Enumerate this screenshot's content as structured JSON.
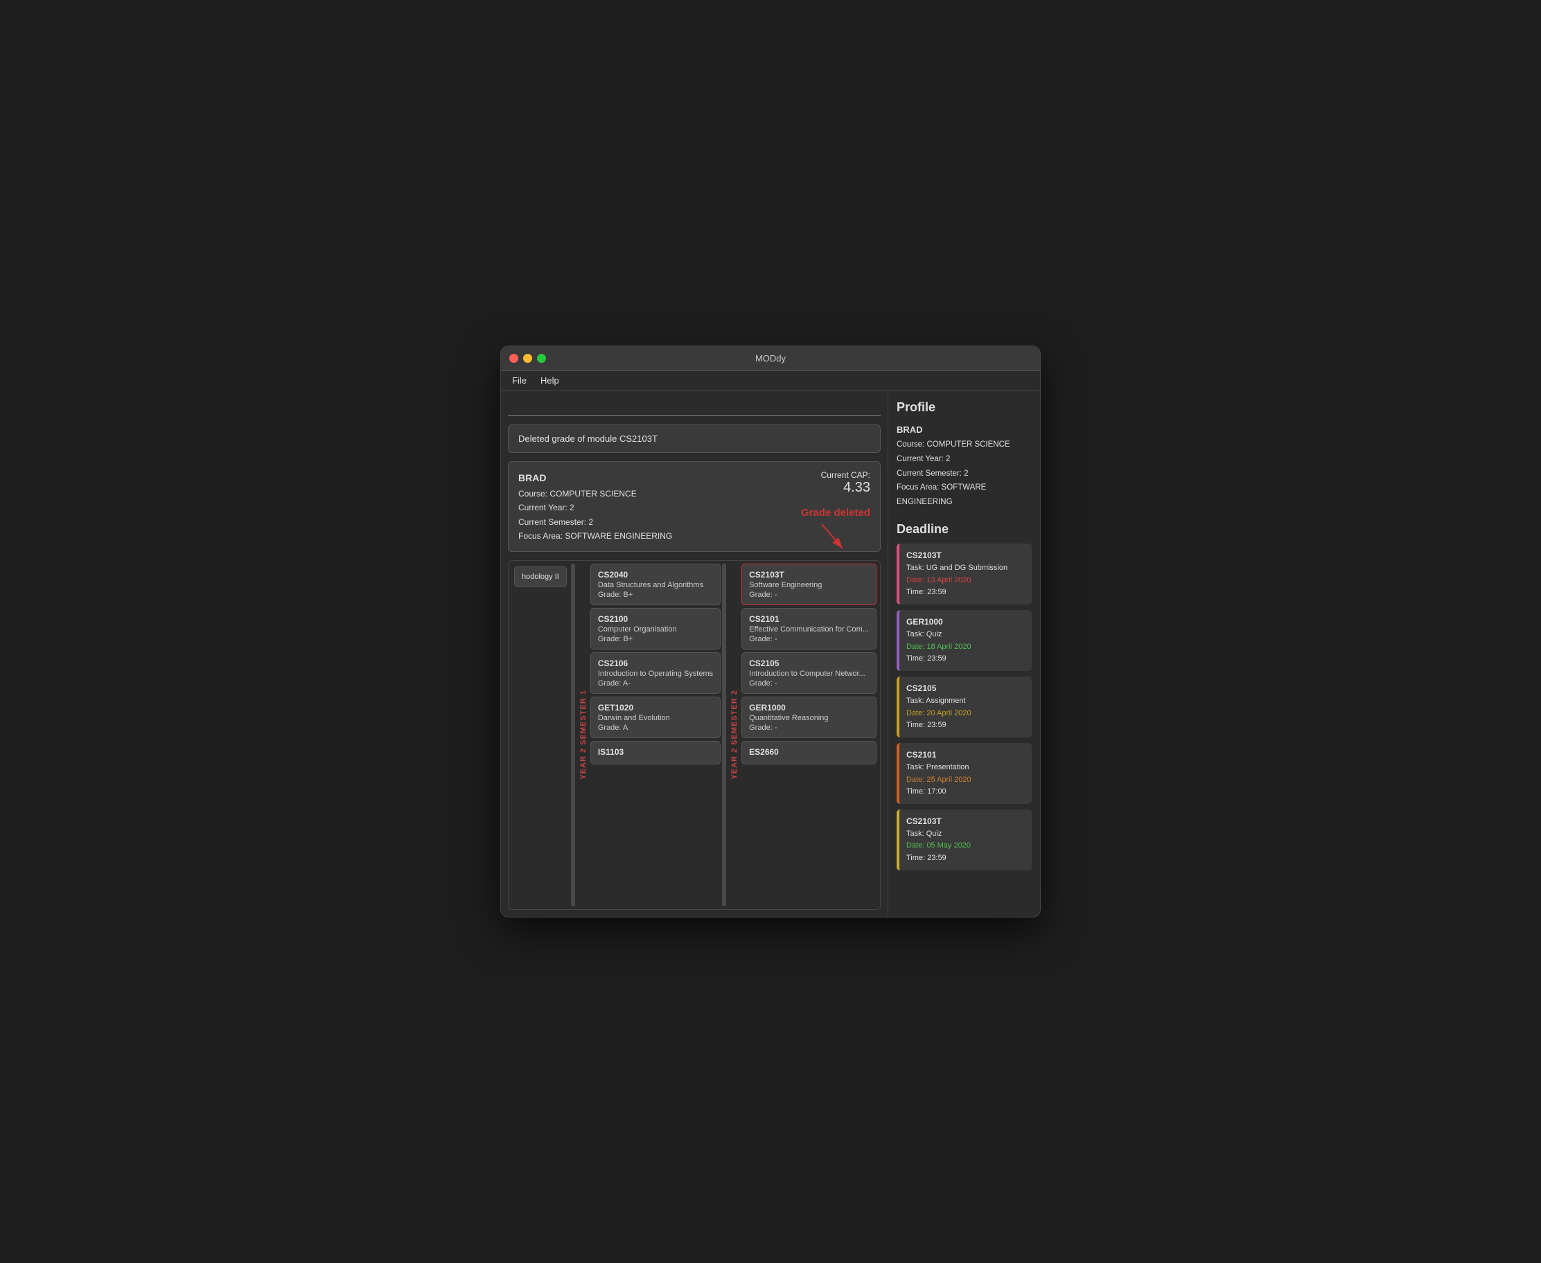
{
  "window": {
    "title": "MODdy"
  },
  "menu": {
    "items": [
      "File",
      "Help"
    ]
  },
  "search": {
    "placeholder": "",
    "value": ""
  },
  "notification": {
    "text": "Deleted grade of module CS2103T"
  },
  "profile_card": {
    "name": "BRAD",
    "course": "Course: COMPUTER SCIENCE",
    "year": "Current Year: 2",
    "semester": "Current Semester: 2",
    "focus": "Focus Area: SOFTWARE ENGINEERING",
    "cap_label": "Current CAP:",
    "cap_value": "4.33",
    "grade_deleted": "Grade deleted"
  },
  "modules": {
    "semester1_label": "YEAR 2 SEMESTER 1",
    "semester2_label": "YEAR 2 SEMESTER 2",
    "partial_left_label": "hodology II",
    "col1": [
      {
        "code": "CS2040",
        "name": "Data Structures and Algorithms",
        "grade": "Grade: B+"
      },
      {
        "code": "CS2100",
        "name": "Computer Organisation",
        "grade": "Grade: B+"
      },
      {
        "code": "CS2106",
        "name": "Introduction to Operating Systems",
        "grade": "Grade: A-"
      },
      {
        "code": "GET1020",
        "name": "Darwin and Evolution",
        "grade": "Grade: A"
      },
      {
        "code": "IS1103",
        "name": "",
        "grade": ""
      }
    ],
    "col2": [
      {
        "code": "CS2103T",
        "name": "Software Engineering",
        "grade": "Grade: -",
        "highlighted": true
      },
      {
        "code": "CS2101",
        "name": "Effective Communication for Com...",
        "grade": "Grade: -"
      },
      {
        "code": "CS2105",
        "name": "Introduction to Computer Networ...",
        "grade": "Grade: -"
      },
      {
        "code": "GER1000",
        "name": "Quantitative Reasoning",
        "grade": "Grade: -"
      },
      {
        "code": "ES2660",
        "name": "",
        "grade": ""
      }
    ]
  },
  "profile_right": {
    "title": "Profile",
    "name": "BRAD",
    "course": "Course: COMPUTER SCIENCE",
    "year": "Current Year: 2",
    "semester": "Current Semester: 2",
    "focus": "Focus Area: SOFTWARE ENGINEERING"
  },
  "deadlines": {
    "title": "Deadline",
    "items": [
      {
        "code": "CS2103T",
        "task": "Task: UG and DG Submission",
        "date": "Date: 13 April 2020",
        "time": "Time: 23:59",
        "color_class": "dl-pink",
        "date_color": "date-red"
      },
      {
        "code": "GER1000",
        "task": "Task: Quiz",
        "date": "Date: 18 April 2020",
        "time": "Time: 23:59",
        "color_class": "dl-purple",
        "date_color": "date-green"
      },
      {
        "code": "CS2105",
        "task": "Task: Assignment",
        "date": "Date: 20 April 2020",
        "time": "Time: 23:59",
        "color_class": "dl-yellow",
        "date_color": "date-yellow"
      },
      {
        "code": "CS2101",
        "task": "Task: Presentation",
        "date": "Date: 25 April 2020",
        "time": "Time: 17:00",
        "color_class": "dl-orange",
        "date_color": "date-orange"
      },
      {
        "code": "CS2103T",
        "task": "Task: Quiz",
        "date": "Date: 05 May 2020",
        "time": "Time: 23:59",
        "color_class": "dl-yellow2",
        "date_color": "date-green"
      }
    ]
  }
}
